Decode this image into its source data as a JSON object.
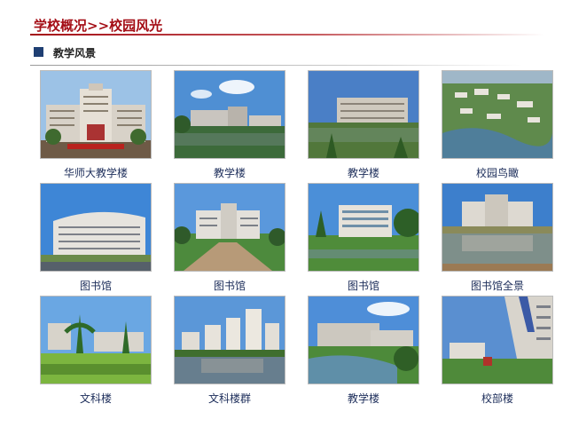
{
  "header": {
    "title": "学校概况>>校园风光"
  },
  "section": {
    "title": "教学风景"
  },
  "gallery": {
    "items": [
      {
        "caption": "华师大教学楼",
        "icon": "building-photo"
      },
      {
        "caption": "教学楼",
        "icon": "building-photo"
      },
      {
        "caption": "教学楼",
        "icon": "building-photo"
      },
      {
        "caption": "校园鸟瞰",
        "icon": "aerial-photo"
      },
      {
        "caption": "图书馆",
        "icon": "building-photo"
      },
      {
        "caption": "图书馆",
        "icon": "building-photo"
      },
      {
        "caption": "图书馆",
        "icon": "building-photo"
      },
      {
        "caption": "图书馆全景",
        "icon": "building-photo"
      },
      {
        "caption": "文科楼",
        "icon": "building-photo"
      },
      {
        "caption": "文科楼群",
        "icon": "building-photo"
      },
      {
        "caption": "教学楼",
        "icon": "building-photo"
      },
      {
        "caption": "校部楼",
        "icon": "building-photo"
      }
    ]
  },
  "colors": {
    "title": "#a40d15",
    "bullet": "#1f3f73",
    "caption": "#1c2d5a"
  }
}
